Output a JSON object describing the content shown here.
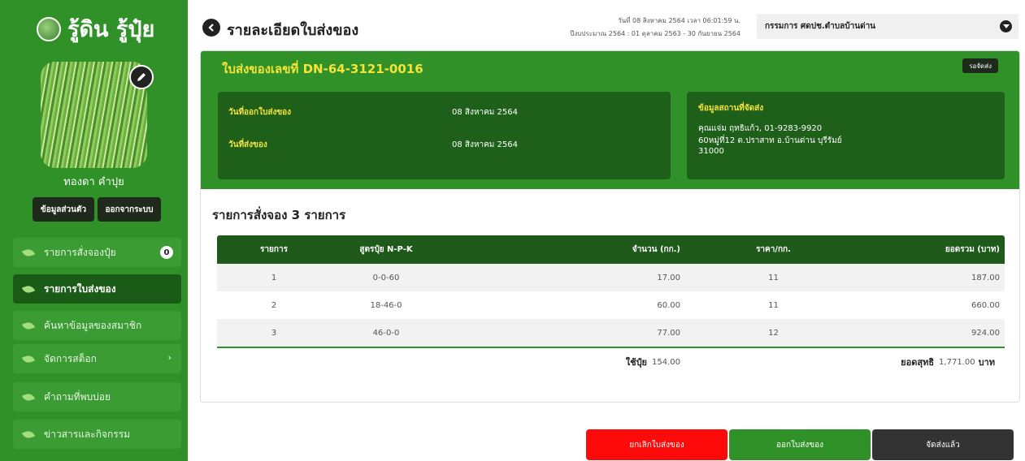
{
  "sidebar": {
    "brand": "รู้ดิน รู้ปุ๋ย",
    "user_name": "ทองดา คำปุย",
    "profile_btn": "ข้อมูลส่วนตัว",
    "logout_btn": "ออกจากระบบ",
    "menu": [
      {
        "label": "รายการสั่งจองปุ๋ย",
        "badge": "0"
      },
      {
        "label": "รายการใบส่งของ"
      },
      {
        "label": "ค้นหาข้อมูลของสมาชิก"
      },
      {
        "label": "จัดการสต็อก",
        "chevron": "›"
      },
      {
        "label": "คำถามที่พบบ่อย"
      },
      {
        "label": "ข่าวสารและกิจกรรม"
      }
    ]
  },
  "header": {
    "title": "รายละเอียดใบส่งของ",
    "date_line1": "วันที่ 08 สิงหาคม 2564 เวลา 06:01:59 น.",
    "date_line2": "ปีงบประมาณ 2564 : 01 ตุลาคม 2563 - 30 กันยายน 2564",
    "user_select": "กรรมการ ศดปช.ตำบลบ้านด่าน"
  },
  "delivery": {
    "doc_title": "ใบส่งของเลขที่ DN-64-3121-0016",
    "status": "รอจัดส่ง",
    "issue_label": "วันที่ออกใบส่งของ",
    "issue_value": "08 สิงหาคม 2564",
    "ship_label": "วันที่ส่งของ",
    "ship_value": "08 สิงหาคม 2564",
    "addr_label": "ข้อมูลสถานที่จัดส่ง",
    "addr_line1": "คุณแจ่ม ฤทธิแก้ว, 01-9283-9920",
    "addr_line2": "60หมู่ที่12 ต.ปราสาท อ.บ้านด่าน บุรีรัมย์",
    "addr_line3": "31000"
  },
  "orders": {
    "section_title": "รายการสั่งจอง 3 รายการ",
    "columns": [
      "รายการ",
      "สูตรปุ๋ย N-P-K",
      "จำนวน (กก.)",
      "ราคา/กก.",
      "ยอดรวม (บาท)"
    ],
    "rows": [
      {
        "no": "1",
        "formula": "0-0-60",
        "qty": "17.00",
        "price": "11",
        "total": "187.00"
      },
      {
        "no": "2",
        "formula": "18-46-0",
        "qty": "60.00",
        "price": "11",
        "total": "660.00"
      },
      {
        "no": "3",
        "formula": "46-0-0",
        "qty": "77.00",
        "price": "12",
        "total": "924.00"
      }
    ],
    "footer_qty_label": "ใช้ปุ๋ย",
    "footer_qty_value": "154.00",
    "footer_total_label": "ยอดสุทธิ",
    "footer_total_value": "1,771.00",
    "footer_total_unit": "บาท"
  },
  "actions": {
    "cancel": "ยกเลิกใบส่งของ",
    "issue": "ออกใบส่งของ",
    "delivered": "จัดส่งแล้ว"
  },
  "colors": {
    "brand_green": "#2f9127",
    "dark_green": "#1e5f1a",
    "accent_yellow": "#f5e33a",
    "cancel_red": "#ff0a0a",
    "dark_button": "#333333"
  }
}
